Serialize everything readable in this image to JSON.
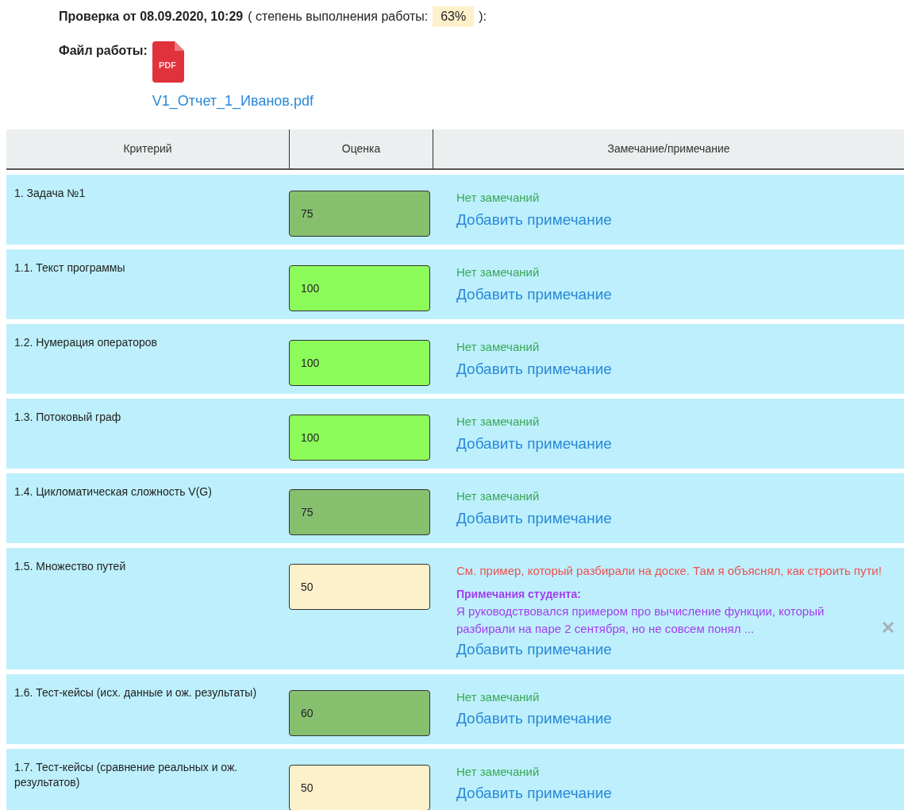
{
  "check": {
    "title": "Проверка от 08.09.2020, 10:29",
    "open": "( степень выполнения работы:",
    "percent": "63%",
    "close": "):"
  },
  "file": {
    "label": "Файл работы:",
    "icon_label": "PDF",
    "name": "V1_Отчет_1_Иванов.pdf"
  },
  "table": {
    "columns": [
      "Критерий",
      "Оценка",
      "Замечание/примечание"
    ],
    "rows": [
      {
        "criterion": "1. Задача №1",
        "score": "75",
        "color": "#86bf6e",
        "remark": {
          "kind": "none",
          "text": "Нет замечаний"
        },
        "add_link": "Добавить примечание"
      },
      {
        "criterion": "1.1. Текст программы",
        "score": "100",
        "color": "#8cfc5a",
        "remark": {
          "kind": "none",
          "text": "Нет замечаний"
        },
        "add_link": "Добавить примечание"
      },
      {
        "criterion": "1.2. Нумерация операторов",
        "score": "100",
        "color": "#8cfc5a",
        "remark": {
          "kind": "none",
          "text": "Нет замечаний"
        },
        "add_link": "Добавить примечание"
      },
      {
        "criterion": "1.3. Потоковый граф",
        "score": "100",
        "color": "#8cfc5a",
        "remark": {
          "kind": "none",
          "text": "Нет замечаний"
        },
        "add_link": "Добавить примечание"
      },
      {
        "criterion": "1.4. Цикломатическая сложность V(G)",
        "score": "75",
        "color": "#86bf6e",
        "remark": {
          "kind": "none",
          "text": "Нет замечаний"
        },
        "add_link": "Добавить примечание"
      },
      {
        "criterion": "1.5. Множество путей",
        "score": "50",
        "color": "#fdf1cc",
        "remark": {
          "kind": "teacher",
          "text": "См. пример, который разбирали на доске. Там я объяснял, как строить пути!"
        },
        "student_note": {
          "label": "Примечания студента:",
          "text": "Я руководствовался примером про вычисление функции, который разбирали на паре 2 сентября, но не совсем понял ..."
        },
        "add_link": "Добавить примечание"
      },
      {
        "criterion": "1.6. Тест-кейсы (исх. данные и ож. результаты)",
        "score": "60",
        "color": "#86bf6e",
        "remark": {
          "kind": "none",
          "text": "Нет замечаний"
        },
        "add_link": "Добавить примечание"
      },
      {
        "criterion": "1.7. Тест-кейсы (сравнение реальных и ож. результатов)",
        "score": "50",
        "color": "#fdf1cc",
        "remark": {
          "kind": "none",
          "text": "Нет замечаний"
        },
        "add_link": "Добавить примечание"
      }
    ]
  }
}
